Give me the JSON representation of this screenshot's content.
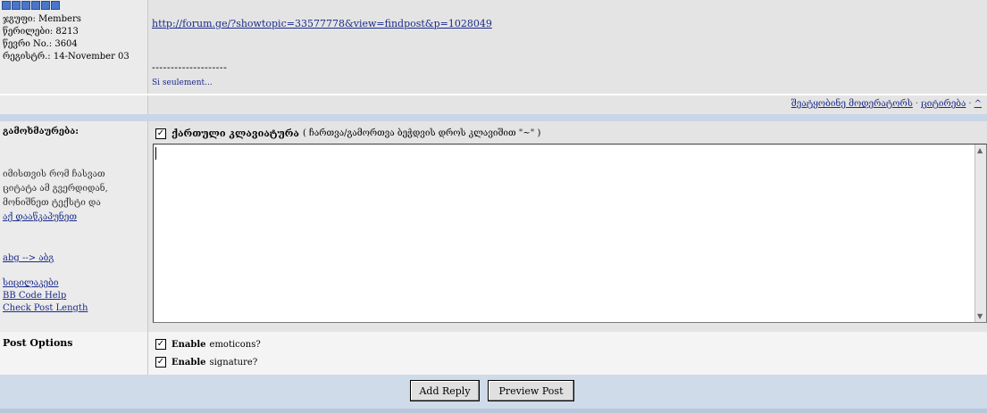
{
  "post": {
    "stars": 6,
    "group": "ჯგუფი: Members",
    "posts_count": "წერილები: 8213",
    "member_no": "წევრი No.: 3604",
    "joined": "რეგისტრ.: 14-November 03",
    "link": "http://forum.ge/?showtopic=33577778&view=findpost&p=1028049",
    "signature_separator": "--------------------",
    "signature_text": "Si seulement...",
    "footer": {
      "report": "შეატყობინე მოდერატორს",
      "quote": "ციტირება",
      "top": "^"
    }
  },
  "form": {
    "reply_label": "გამოხმაურება:",
    "help_text": "იმისთვის რომ ჩასვათ ციტატა ამ გვერდიდან, მონიშნეთ ტექსტი და",
    "help_link": "აქ დააწკაპუნეთ",
    "translit": "abg --> აბგ",
    "smilies": "სიცილაკები",
    "bbcode": "BB Code Help",
    "check_length": "Check Post Length",
    "keyboard_label": "ქართული კლავიატურა",
    "keyboard_note": "( ჩართვა/გამორთვა ბეჭდვის დროს კლავიშით \"~\" )",
    "keyboard_checked": true,
    "message_value": ""
  },
  "options": {
    "label": "Post Options",
    "emoticons_bold": "Enable",
    "emoticons_rest": "emoticons?",
    "signature_bold": "Enable",
    "signature_rest": "signature?"
  },
  "buttons": {
    "add_reply": "Add Reply",
    "preview": "Preview Post"
  }
}
